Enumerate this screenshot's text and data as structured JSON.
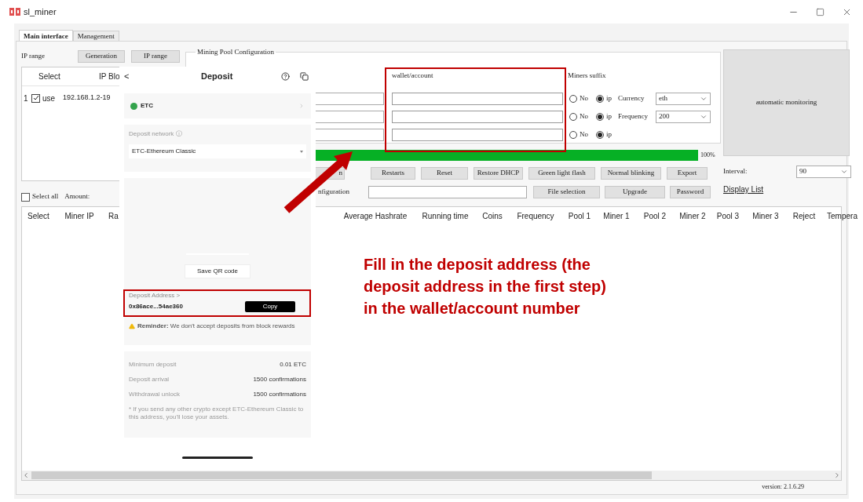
{
  "window": {
    "title": "sl_miner"
  },
  "tabs": [
    {
      "label": "Main interface",
      "selected": true
    },
    {
      "label": "Management",
      "selected": false
    }
  ],
  "ip_range": {
    "label": "IP range",
    "buttons": [
      "Generation",
      "IP range"
    ],
    "columns": [
      "Select",
      "IP Blo"
    ],
    "rows": [
      {
        "index": "1",
        "checked": true,
        "select": "use",
        "ip_block": "192.168.1.2-19"
      }
    ]
  },
  "mining_pool": {
    "title": "Mining Pool Configuration",
    "wallet_header": "wallet/account",
    "suffix_header": "Miners suffix",
    "rows": [
      {
        "options": [
          {
            "label": "No",
            "selected": false
          },
          {
            "label": "ip",
            "selected": true
          }
        ],
        "setting": {
          "label": "Currency",
          "value": "eth"
        }
      },
      {
        "options": [
          {
            "label": "No",
            "selected": false
          },
          {
            "label": "ip",
            "selected": true
          }
        ],
        "setting": {
          "label": "Frequency",
          "value": "200"
        }
      },
      {
        "options": [
          {
            "label": "No",
            "selected": false
          },
          {
            "label": "ip",
            "selected": true
          }
        ]
      }
    ]
  },
  "automatic_monitoring": "automatic monitoring",
  "progress": {
    "level": 1,
    "reading": "100%"
  },
  "action_buttons": [
    "n",
    "Restarts",
    "Reset",
    "Restore DHCP",
    "Green light flash",
    "Normal blinking",
    "Export"
  ],
  "interval": {
    "label": "Interval:",
    "value": "90"
  },
  "select_all": {
    "label": "Select all",
    "checked": false
  },
  "amount_label": "Amount:",
  "configuration": {
    "label": "nfiguration",
    "buttons": [
      "File selection",
      "Upgrade",
      "Password"
    ]
  },
  "display_list": "Display List",
  "miner_table": {
    "columns": [
      "Select",
      "Miner IP",
      "Ra",
      "Average Hashrate",
      "Running time",
      "Coins",
      "Frequency",
      "Pool 1",
      "Miner 1",
      "Pool 2",
      "Miner 2",
      "Pool 3",
      "Miner 3",
      "Reject",
      "Tempera"
    ]
  },
  "version": "version: 2.1.6.29",
  "deposit": {
    "back": "<",
    "title": "Deposit",
    "coin": "ETC",
    "network_label": "Deposit network ⓘ",
    "network": "ETC-Ethereum Classic",
    "save_qr": "Save QR code",
    "address_label": "Deposit Address >",
    "address": "0x86ace...54ae360",
    "copy": "Copy",
    "reminder": "**Reminder:** We don't accept deposits from block rewards",
    "details": [
      {
        "label": "Minimum deposit",
        "value": "0.01 ETC"
      },
      {
        "label": "Deposit arrival",
        "value": "1500 confirmations"
      },
      {
        "label": "Withdrawal unlock",
        "value": "1500 confirmations"
      }
    ],
    "note": "* If you send any other crypto except ETC-Ethereum Classic to this address, you'll lose your assets."
  },
  "annotation": "Fill in the deposit address (the deposit address in the first step) in the wallet/account number"
}
